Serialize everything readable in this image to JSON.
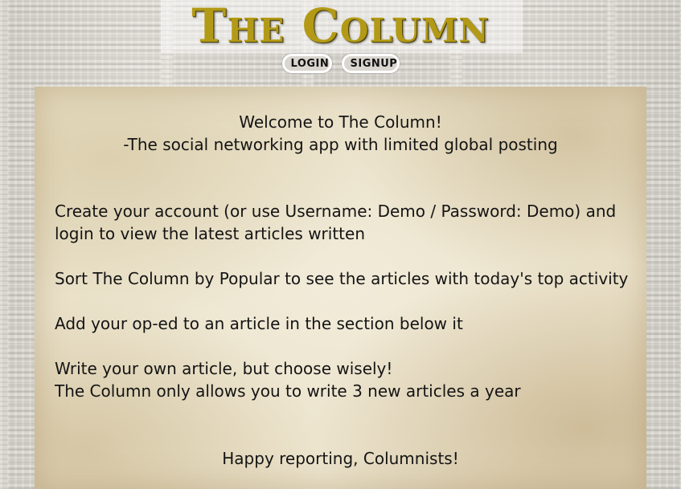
{
  "header": {
    "logo_text": "The Column",
    "login_label": "LOGIN",
    "signup_label": "SIGNUP"
  },
  "welcome": {
    "title": "Welcome to The Column!",
    "tagline": "-The social networking app with limited global posting"
  },
  "instructions": [
    "Create your account (or use Username: Demo / Password: Demo) and login to view the latest articles written",
    "Sort The Column by Popular to see the articles with today's top activity",
    "Add your op-ed to an article in the section below it",
    "Write your own article, but choose wisely!",
    "The Column only allows you to write 3 new articles a year"
  ],
  "signoff": "Happy reporting, Columnists!",
  "colors": {
    "logo_gold": "#b39a16",
    "paper": "#ece4cd",
    "button_bg": "#d9d6cf"
  }
}
